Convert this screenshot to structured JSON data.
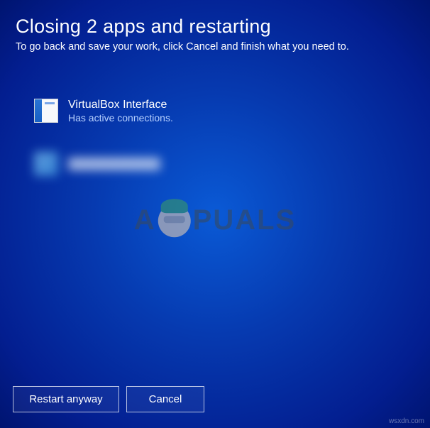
{
  "header": {
    "title": "Closing 2 apps and restarting",
    "subtitle": "To go back and save your work, click Cancel and finish what you need to."
  },
  "apps": [
    {
      "name": "VirtualBox Interface",
      "status": "Has active connections.",
      "icon": "virtualbox-icon"
    }
  ],
  "watermark": {
    "prefix": "A",
    "suffix": "PUALS"
  },
  "buttons": {
    "restart": "Restart anyway",
    "cancel": "Cancel"
  },
  "source": "wsxdn.com"
}
